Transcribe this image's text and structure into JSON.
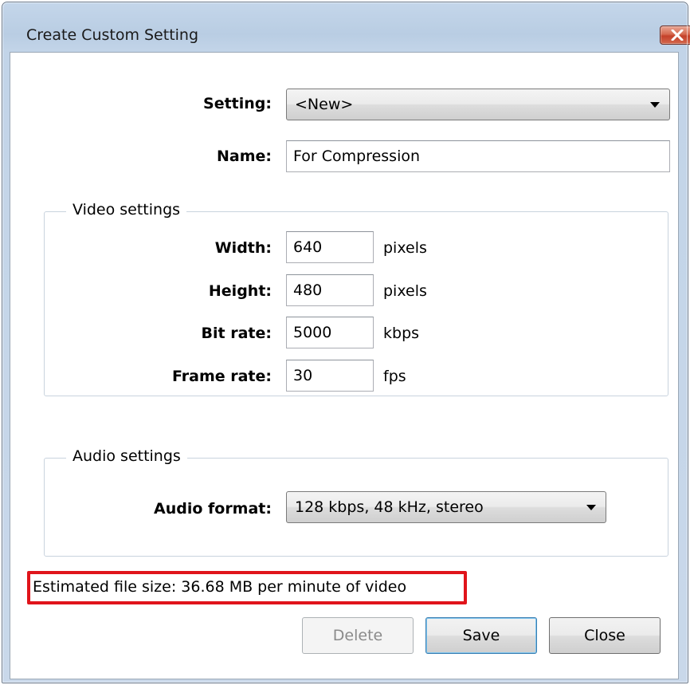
{
  "window": {
    "title": "Create Custom Setting"
  },
  "setting": {
    "label": "Setting:",
    "value": "<New>"
  },
  "name": {
    "label": "Name:",
    "value": "For Compression"
  },
  "video": {
    "caption": "Video settings",
    "width": {
      "label": "Width:",
      "value": "640",
      "unit": "pixels"
    },
    "height": {
      "label": "Height:",
      "value": "480",
      "unit": "pixels"
    },
    "bitrate": {
      "label": "Bit rate:",
      "value": "5000",
      "unit": "kbps"
    },
    "framerate": {
      "label": "Frame rate:",
      "value": "30",
      "unit": "fps"
    }
  },
  "audio": {
    "caption": "Audio settings",
    "format_label": "Audio format:",
    "format_value": "128 kbps, 48 kHz, stereo"
  },
  "status": {
    "estimate": "Estimated file size: 36.68 MB per minute of video"
  },
  "buttons": {
    "delete": "Delete",
    "save": "Save",
    "close": "Close"
  },
  "colors": {
    "highlight": "#e0141b",
    "close_button": "#c4412a"
  },
  "icons": {
    "close": "close-x-icon",
    "dropdown": "chevron-down-icon"
  }
}
